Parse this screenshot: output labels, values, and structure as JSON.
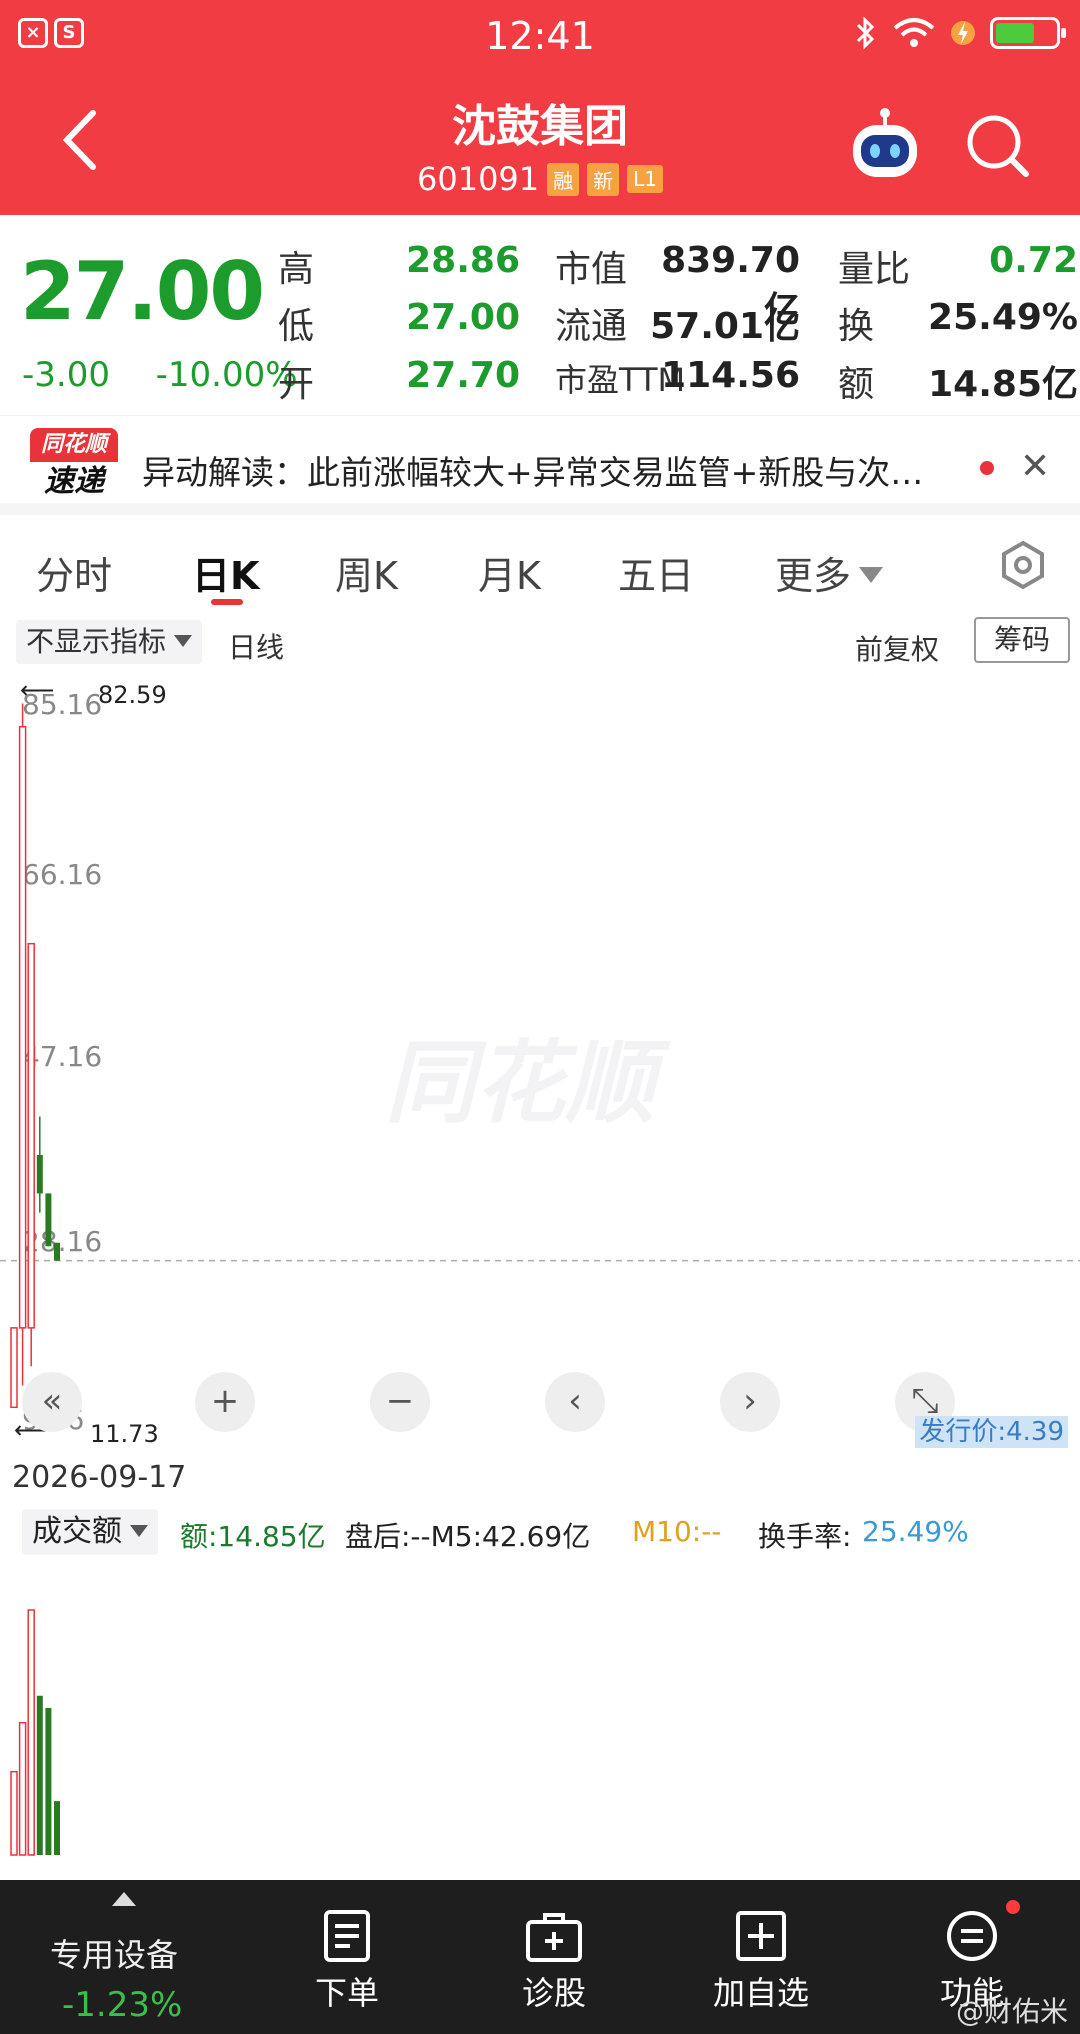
{
  "status": {
    "time": "12:41",
    "app_icons": [
      "×",
      "S"
    ],
    "battery_level": 0.55
  },
  "header": {
    "title": "沈鼓集团",
    "code": "601091",
    "tags": [
      "融",
      "新",
      "L1"
    ],
    "colors": {
      "background": "#f03c42",
      "tag": "#f7a242"
    }
  },
  "quote": {
    "price": "27.00",
    "change": "-3.00",
    "change_pct": "-10.00%",
    "rows": [
      {
        "l1": "高",
        "v1": "28.86",
        "l2": "市值",
        "v2": "839.70亿",
        "l3": "量比",
        "v3": "0.72"
      },
      {
        "l1": "低",
        "v1": "27.00",
        "l2": "流通",
        "v2": "57.01亿",
        "l3": "换",
        "v3": "25.49%"
      },
      {
        "l1": "开",
        "v1": "27.70",
        "l2": "市盈TTM",
        "v2": "114.56",
        "l3": "额",
        "v3": "14.85亿"
      }
    ],
    "colors": {
      "down": "#1c9c2c"
    }
  },
  "news": {
    "logo_top": "同花顺",
    "logo_bottom": "速递",
    "text": "异动解读：此前涨幅较大+异常交易监管+新股与次…"
  },
  "tabs": {
    "items": [
      "分时",
      "日K",
      "周K",
      "月K",
      "五日",
      "更多"
    ],
    "active": "日K"
  },
  "chart_controls": {
    "indicator": "不显示指标",
    "period": "日线",
    "adjust": "前复权",
    "chips": "筹码"
  },
  "chart_data": {
    "type": "candlestick",
    "ylim": [
      9.16,
      85.16
    ],
    "y_ticks": [
      "85.16",
      "66.16",
      "47.16",
      "28.16",
      "9.16"
    ],
    "high_marker": "82.59",
    "low_marker": "11.73",
    "issue_label": "发行价:4.39",
    "date": "2026-09-17",
    "candles": [
      {
        "open": 11.73,
        "close": 20.0,
        "high": 20.0,
        "low": 11.73,
        "dir": "up"
      },
      {
        "open": 20.0,
        "close": 82.59,
        "high": 85.0,
        "low": 14.0,
        "dir": "up"
      },
      {
        "open": 20.0,
        "close": 60.0,
        "high": 60.0,
        "low": 16.0,
        "dir": "up"
      },
      {
        "open": 38.0,
        "close": 34.0,
        "high": 42.0,
        "low": 32.0,
        "dir": "down"
      },
      {
        "open": 34.0,
        "close": 28.5,
        "high": 34.0,
        "low": 28.5,
        "dir": "down"
      },
      {
        "open": 28.86,
        "close": 27.0,
        "high": 28.86,
        "low": 27.0,
        "dir": "down"
      }
    ],
    "volumes": [
      {
        "value": 0.34,
        "dir": "up"
      },
      {
        "value": 0.54,
        "dir": "up"
      },
      {
        "value": 1.0,
        "dir": "up"
      },
      {
        "value": 0.65,
        "dir": "down"
      },
      {
        "value": 0.6,
        "dir": "down"
      },
      {
        "value": 0.22,
        "dir": "down"
      }
    ]
  },
  "volume_panel": {
    "selector": "成交额",
    "amount": "额:14.85亿",
    "afterhours": "盘后:--M5:42.69亿",
    "m10": "M10:--",
    "turnover_label": "换手率:",
    "turnover_value": "25.49%"
  },
  "bottom_bar": {
    "device": "专用设备",
    "device_pct": "-1.23%",
    "items": [
      "下单",
      "诊股",
      "加自选",
      "功能"
    ],
    "credit": "@财佑米"
  }
}
